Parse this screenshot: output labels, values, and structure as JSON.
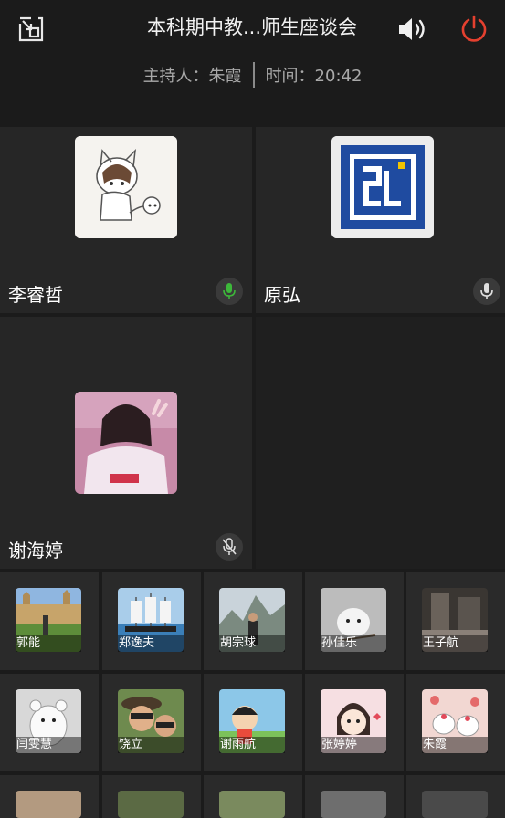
{
  "header": {
    "title": "本科期中教...师生座谈会",
    "host": "主持人：朱霞",
    "time": "时间：20:42"
  },
  "icons": {
    "shrink": "shrink-window-icon",
    "speaker": "speaker-icon",
    "power": "power-icon",
    "mic_on": "microphone-icon",
    "mic_off": "microphone-muted-icon"
  },
  "colors": {
    "background": "#1b1b1b",
    "tile": "#262626",
    "power": "#e5402f",
    "mic_active": "#3db83a"
  },
  "main_tiles": [
    {
      "name": "李睿哲",
      "mic": "active"
    },
    {
      "name": "原弘",
      "mic": "idle"
    },
    {
      "name": "谢海婷",
      "mic": "muted"
    }
  ],
  "participants": [
    {
      "name": "郭能"
    },
    {
      "name": "郑逸夫"
    },
    {
      "name": "胡宗球"
    },
    {
      "name": "孙佳乐"
    },
    {
      "name": "王子航"
    },
    {
      "name": "闫雯慧"
    },
    {
      "name": "饶立"
    },
    {
      "name": "谢雨航"
    },
    {
      "name": "张婷婷"
    },
    {
      "name": "朱霞"
    }
  ]
}
